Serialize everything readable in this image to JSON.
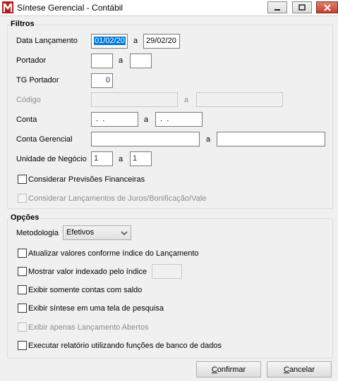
{
  "window": {
    "title": "Síntese Gerencial - Contábil"
  },
  "filtros": {
    "title": "Filtros",
    "data_lancamento": {
      "label": "Data Lançamento",
      "from": "01/02/20",
      "sep": "a",
      "to": "29/02/20"
    },
    "portador": {
      "label": "Portador",
      "from": "",
      "sep": "a",
      "to": ""
    },
    "tg_portador": {
      "label": "TG Portador",
      "value": "0"
    },
    "codigo": {
      "label": "Código",
      "from": "",
      "sep": "a",
      "to": ""
    },
    "conta": {
      "label": "Conta",
      "from": " .  .",
      "sep": "a",
      "to": " .  ."
    },
    "conta_gerencial": {
      "label": "Conta Gerencial",
      "from": "",
      "sep": "a",
      "to": ""
    },
    "unidade_negocio": {
      "label": "Unidade de Negócio",
      "from": "1",
      "sep": "a",
      "to": "1"
    },
    "considerar_previsoes": {
      "label": "Considerar Previsões Financeiras",
      "checked": false
    },
    "considerar_juros": {
      "label": "Considerar Lançamentos de Juros/Bonificação/Vale",
      "checked": false
    }
  },
  "opcoes": {
    "title": "Opções",
    "metodologia": {
      "label": "Metodologia",
      "value": "Efetivos"
    },
    "atualizar_valores": {
      "label": "Atualizar valores conforme índice do Lançamento",
      "checked": false
    },
    "mostrar_indexado": {
      "label": "Mostrar valor indexado pelo índice",
      "checked": false,
      "index_value": ""
    },
    "exibir_contas_saldo": {
      "label": "Exibir somente contas com saldo",
      "checked": false
    },
    "exibir_sintese_tela": {
      "label": "Exibir síntese em uma tela de pesquisa",
      "checked": false
    },
    "exibir_lancamento_abertos": {
      "label": "Exibir apenas Lançamento Abertos",
      "checked": false
    },
    "executar_relatorio": {
      "label": "Executar relatório utilizando funções de banco de dados",
      "checked": false
    }
  },
  "buttons": {
    "confirmar_accel": "C",
    "confirmar_rest": "onfirmar",
    "cancelar_accel": "C",
    "cancelar_rest": "ancelar"
  }
}
